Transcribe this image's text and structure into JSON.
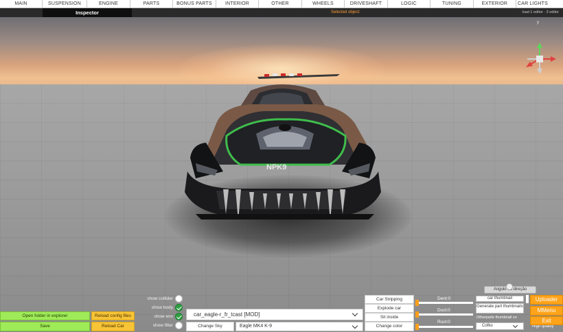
{
  "tabs": [
    "MAIN",
    "SUSPENSION",
    "ENGINE",
    "PARTS",
    "BONUS PARTS",
    "INTERIOR",
    "OTHER",
    "WHEELS",
    "DRIVESHAFT",
    "LOGIC",
    "TUNING",
    "EXTERIOR",
    "CAR LIGHTS"
  ],
  "subbar": {
    "inspector_label": "Inspector",
    "selected_label": "Selected object:",
    "status_label": "load 1 editor · 3 editor"
  },
  "gizmo": {
    "y_label": "y"
  },
  "viewport": {
    "angle_label": "Angulo da direção"
  },
  "left_buttons": {
    "open_folder": "Open folder in explorer",
    "save": "Save",
    "reload_config": "Reload config files",
    "reload_car": "Reload Car"
  },
  "toggles": [
    {
      "label": "show collider",
      "on": false
    },
    {
      "label": "show body",
      "on": true
    },
    {
      "label": "show env",
      "on": true
    },
    {
      "label": "show filter",
      "on": false
    }
  ],
  "car_select": {
    "value": "car_eagle-r_fr_tcast  [MOD]"
  },
  "change_sky": "Change Sky",
  "sky_select": {
    "value": "Eagle MK4 K-9"
  },
  "panel": {
    "car_stripping": "Car Stripping",
    "explode_car": "Explode car",
    "sit_inside": "Sit inside",
    "change_color": "Change color"
  },
  "sliders": [
    {
      "label": "Dent:0",
      "value": 0
    },
    {
      "label": "Dust:0",
      "value": 0
    },
    {
      "label": "Rust:0",
      "value": 0
    }
  ],
  "thumbnails": {
    "car_thumbnail": "car thumbnail",
    "generate_parts": "Generate part thumbnails",
    "otherparts_label": "Otherparts thumbnail co",
    "otherparts_value": "Cofko",
    "quality_label": "High quality"
  },
  "right_buttons": {
    "uploader": "Uploader",
    "mmenu": "MMenu",
    "exit": "Exit"
  },
  "colors": {
    "accent_orange": "#ffa31a",
    "green_button": "#9fea58",
    "yellow_button": "#f6c436",
    "toggle_on": "#2ea043"
  }
}
